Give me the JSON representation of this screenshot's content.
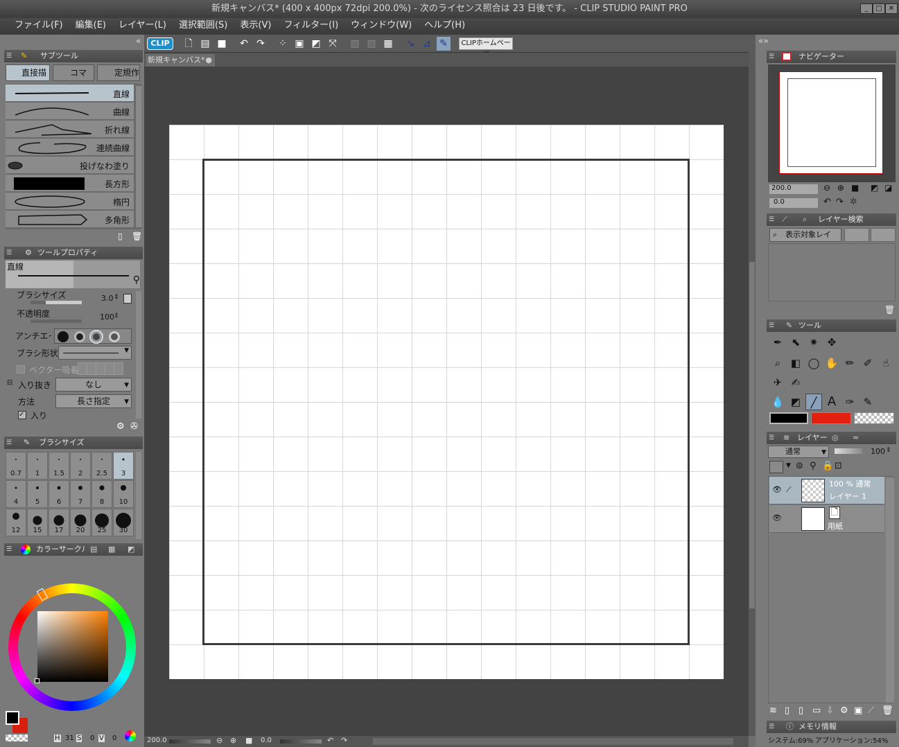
{
  "window": {
    "title": "新規キャンバス* (400 x 400px 72dpi 200.0%)  - 次のライセンス照合は 23 日後です。 - CLIP STUDIO PAINT PRO"
  },
  "menu": [
    "ファイル(F)",
    "編集(E)",
    "レイヤー(L)",
    "選択範囲(S)",
    "表示(V)",
    "フィルター(I)",
    "ウィンドウ(W)",
    "ヘルプ(H)"
  ],
  "toolbar": {
    "logo": "CLIP",
    "home_button": "CLIPホームページ"
  },
  "canvas_tab": {
    "label": "新規キャンバス*"
  },
  "subtool": {
    "panel_title": "サブツール",
    "tabs": [
      "直接描",
      "コマ枠",
      "定規作"
    ],
    "items": [
      "直線",
      "曲線",
      "折れ線",
      "連続曲線",
      "投げなわ塗り",
      "長方形",
      "楕円",
      "多角形"
    ]
  },
  "toolprop": {
    "panel_title": "ツールプロパティ",
    "tool_name": "直線",
    "brush_size_label": "ブラシサイズ",
    "brush_size_value": "3.0",
    "opacity_label": "不透明度",
    "opacity_value": "100",
    "antialias_label": "アンチエイリ",
    "brush_shape_label": "ブラシ形状",
    "vector_snap_label": "ベクター吸着",
    "taper_label": "入り抜き",
    "taper_value": "なし",
    "method_label": "方法",
    "method_value": "長さ指定",
    "entry_label": "入り"
  },
  "brushsize": {
    "panel_title": "ブラシサイズ",
    "sizes": [
      "0.7",
      "1",
      "1.5",
      "2",
      "2.5",
      "3",
      "4",
      "5",
      "6",
      "7",
      "8",
      "10",
      "12",
      "15",
      "17",
      "20",
      "25",
      "30"
    ]
  },
  "color": {
    "panel_title": "カラーサークル",
    "h_label": "H",
    "h_value": "31",
    "s_label": "S",
    "s_value": "0",
    "v_label": "V",
    "v_value": "0",
    "main_color": "#000000",
    "sub_color": "#e32010"
  },
  "navigator": {
    "panel_title": "ナビゲーター",
    "zoom": "200.0",
    "rotation": "0.0"
  },
  "layer_search": {
    "panel_title": "レイヤー検索",
    "filter": "表示対象レイ"
  },
  "tools": {
    "panel_title": "ツール",
    "main_color": "#000000",
    "sub_color": "#e32010"
  },
  "layers": {
    "panel_title": "レイヤー",
    "blend_mode": "通常",
    "opacity": "100",
    "items": [
      {
        "info": "100 % 通常",
        "name": "レイヤー 1"
      },
      {
        "info": "",
        "name": "用紙"
      }
    ]
  },
  "memory": {
    "panel_title": "メモリ情報",
    "system": "システム:69%",
    "application": "アプリケーション:54%"
  },
  "statusbar": {
    "zoom": "200.0",
    "rotation": "0.0"
  }
}
